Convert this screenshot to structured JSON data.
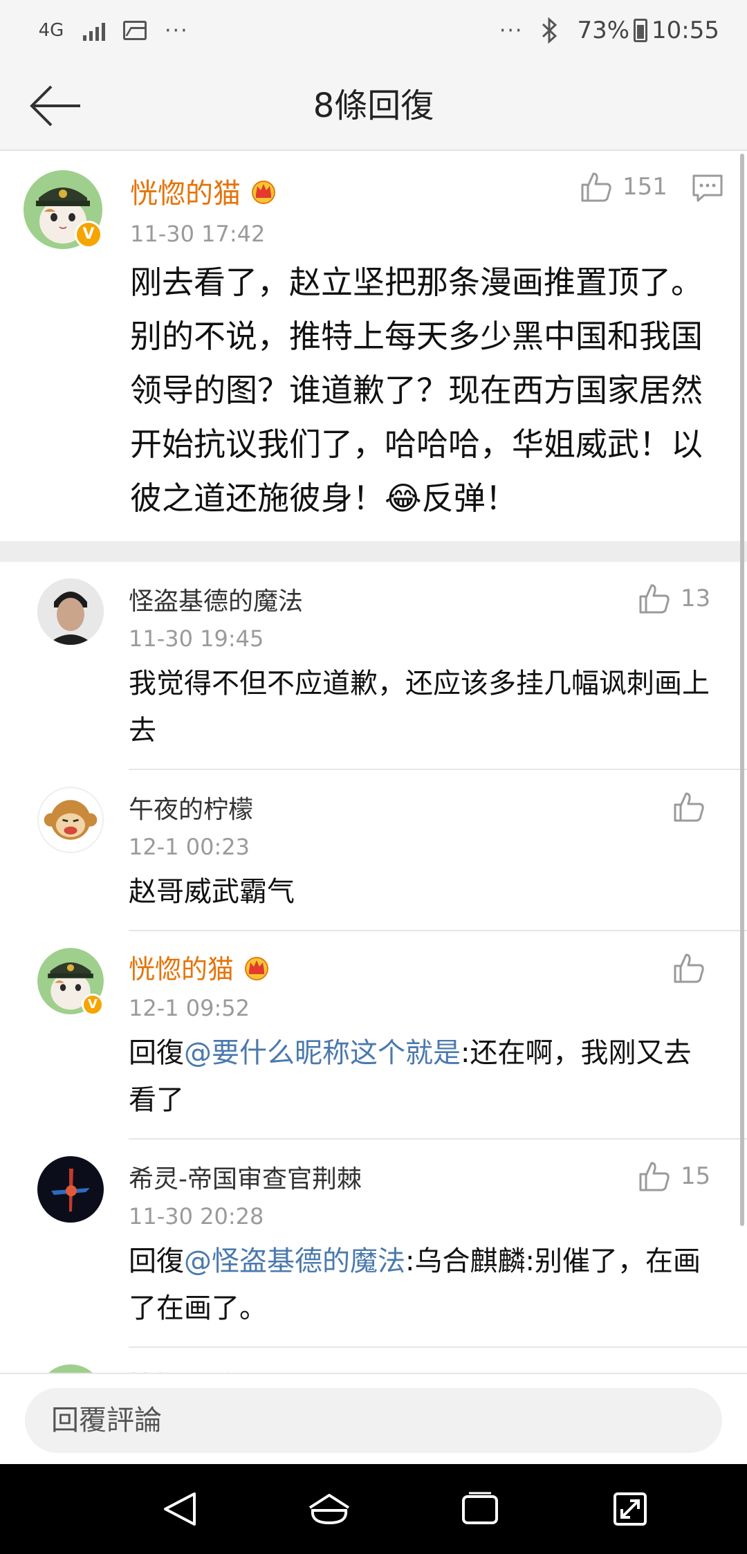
{
  "status_bar": {
    "network": "4G",
    "dots_left": "···",
    "dots_right": "···",
    "battery": "73%",
    "time": "10:55"
  },
  "header": {
    "title": "8條回復"
  },
  "main_comment": {
    "username": "恍惚的猫",
    "time": "11-30 17:42",
    "likes": "151",
    "text_before_emoji": "刚去看了，赵立坚把那条漫画推置顶了。别的不说，推特上每天多少黑中国和我国领导的图？谁道歉了？现在西方国家居然开始抗议我们了，哈哈哈，华姐威武！以彼之道还施彼身！",
    "emoji": "😂",
    "text_after_emoji": "反弹！"
  },
  "replies": [
    {
      "username": "怪盗基德的魔法",
      "time": "11-30 19:45",
      "likes": "13",
      "prefix": "",
      "mention": "",
      "text": "我觉得不但不应道歉，还应该多挂几幅讽刺画上去"
    },
    {
      "username": "午夜的柠檬",
      "time": "12-1 00:23",
      "likes": "",
      "prefix": "",
      "mention": "",
      "text": "赵哥威武霸气"
    },
    {
      "username": "恍惚的猫",
      "time": "12-1 09:52",
      "likes": "",
      "prefix": "回復",
      "mention": "@要什么昵称这个就是",
      "text": ":还在啊，我刚又去看了"
    },
    {
      "username": "希灵-帝国审查官荆棘",
      "time": "11-30 20:28",
      "likes": "15",
      "prefix": "回復",
      "mention": "@怪盗基德的魔法",
      "text": ":乌合麒麟:别催了，在画了在画了。"
    }
  ],
  "partial_next": {
    "username": "恍惚的猫"
  },
  "input": {
    "placeholder": "回覆評論"
  },
  "icons": {
    "back": "arrow-left-icon",
    "like": "thumbs-up-icon",
    "comment": "comment-icon",
    "crown": "vip-crown-icon",
    "nav_back": "triangle-back-icon",
    "nav_home": "home-icon",
    "nav_recents": "recents-icon",
    "nav_expand": "expand-icon"
  },
  "colors": {
    "vip_name": "#e4740a",
    "mention": "#4a79ad",
    "time": "#9a9a9a",
    "verified": "#f6a400"
  }
}
